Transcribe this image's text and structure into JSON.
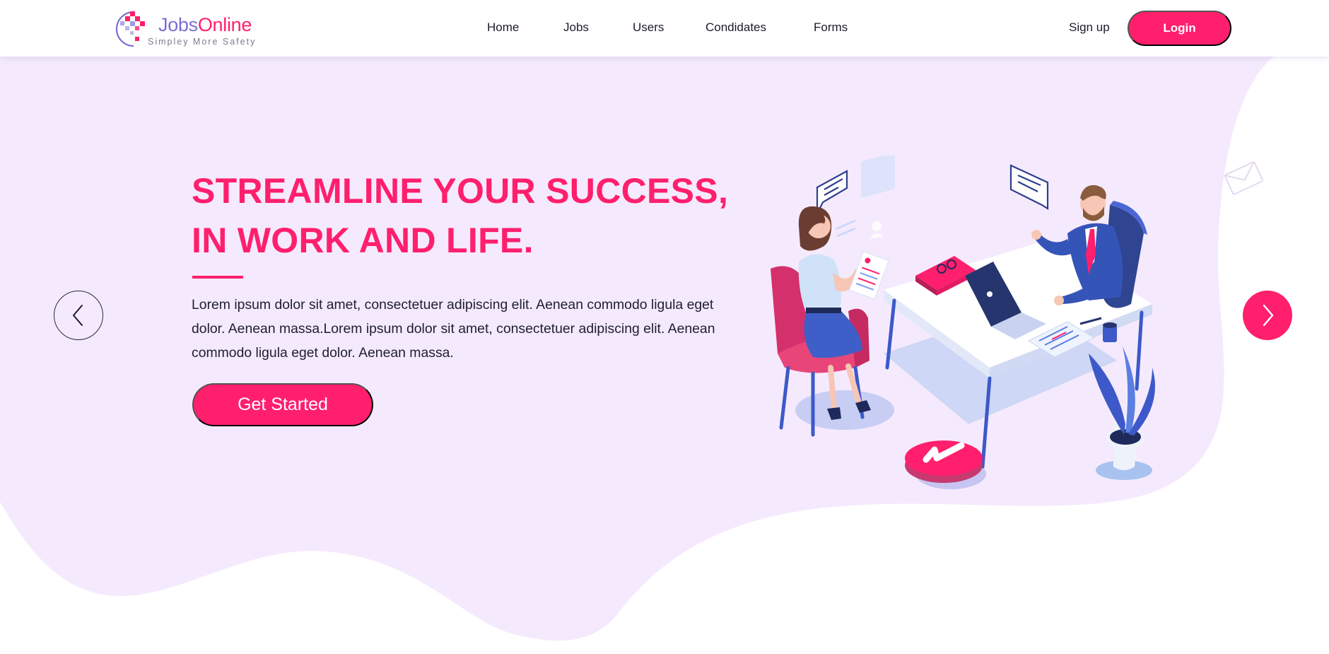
{
  "brand": {
    "name_part1": "Jobs",
    "name_part2": "Online",
    "tagline": "Simpley More Safety"
  },
  "nav": {
    "items": [
      {
        "label": "Home"
      },
      {
        "label": "Jobs"
      },
      {
        "label": "Users"
      },
      {
        "label": "Condidates"
      },
      {
        "label": "Forms"
      }
    ],
    "signup_label": "Sign up",
    "login_label": "Login"
  },
  "hero": {
    "title_line1": "STREAMLINE YOUR SUCCESS,",
    "title_line2": "IN WORK AND LIFE.",
    "description": "Lorem ipsum dolor sit amet, consectetuer adipiscing elit. Aenean commodo ligula eget dolor. Aenean massa.Lorem ipsum dolor sit amet, consectetuer adipiscing elit. Aenean commodo ligula eget dolor. Aenean massa.",
    "cta_label": "Get Started"
  },
  "icons": {
    "prev": "chevron-left-icon",
    "next": "chevron-right-icon",
    "illustration": "office-interview-illustration",
    "decor": "envelope-icon"
  },
  "colors": {
    "accent": "#ff1f6d",
    "brand_purple": "#7a6fd3",
    "hero_background": "#f5eafd"
  }
}
